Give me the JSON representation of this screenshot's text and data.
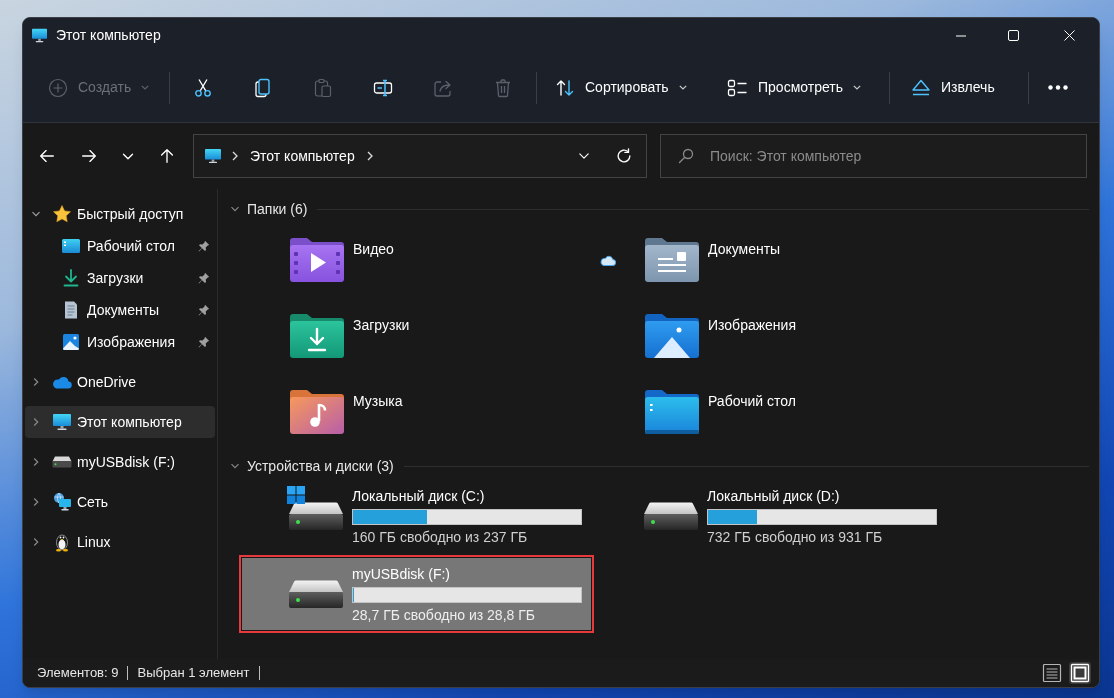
{
  "window": {
    "title": "Этот компьютер"
  },
  "toolbar": {
    "groups": [
      [
        {
          "kind": "new",
          "label": "Создать",
          "disabled": true,
          "dropdown": true
        }
      ],
      [
        {
          "kind": "cut",
          "disabled": false
        },
        {
          "kind": "copy",
          "disabled": false
        },
        {
          "kind": "paste",
          "disabled": true
        },
        {
          "kind": "rename",
          "disabled": false
        },
        {
          "kind": "share",
          "disabled": true
        },
        {
          "kind": "delete",
          "disabled": true
        }
      ],
      [
        {
          "kind": "sort",
          "label": "Сортировать",
          "disabled": false,
          "dropdown": true
        },
        {
          "kind": "view",
          "label": "Просмотреть",
          "disabled": false,
          "dropdown": true
        }
      ],
      [
        {
          "kind": "eject",
          "label": "Извлечь",
          "disabled": false,
          "dropdown": false
        }
      ],
      [
        {
          "kind": "more",
          "disabled": false
        }
      ]
    ]
  },
  "navigation": {
    "buttons": [
      {
        "kind": "back"
      },
      {
        "kind": "forward"
      },
      {
        "kind": "recent"
      },
      {
        "kind": "up"
      }
    ],
    "address": {
      "kind": "computer",
      "crumbs": [
        "Этот компьютер"
      ]
    },
    "search": {
      "placeholder": "Поиск: Этот компьютер"
    }
  },
  "sidebar": {
    "items": [
      {
        "label": "Быстрый доступ",
        "kind": "quick_access",
        "expanded": true,
        "selected": false,
        "children": [
          {
            "label": "Рабочий стол",
            "kind": "desktop",
            "pinned": true,
            "selected": false
          },
          {
            "label": "Загрузки",
            "kind": "downloads",
            "pinned": true,
            "selected": false
          },
          {
            "label": "Документы",
            "kind": "documents",
            "pinned": true,
            "selected": false
          },
          {
            "label": "Изображения",
            "kind": "pictures",
            "pinned": true,
            "selected": false
          }
        ]
      },
      {
        "label": "OneDrive",
        "kind": "onedrive",
        "expanded": false,
        "selected": false
      },
      {
        "label": "Этот компьютер",
        "kind": "computer",
        "expanded": false,
        "selected": true
      },
      {
        "label": "myUSBdisk (F:)",
        "kind": "drive",
        "expanded": false,
        "selected": false
      },
      {
        "label": "Сеть",
        "kind": "network",
        "expanded": false,
        "selected": false
      },
      {
        "label": "Linux",
        "kind": "linux",
        "expanded": false,
        "selected": false
      }
    ]
  },
  "sections": [
    {
      "title": "Папки (6)",
      "kind": "folders",
      "expanded": true,
      "items": [
        {
          "name": "Видео",
          "kind": "videos",
          "cloud": false,
          "selected": false
        },
        {
          "name": "Документы",
          "kind": "documents",
          "cloud": true,
          "selected": false
        },
        {
          "name": "Загрузки",
          "kind": "downloads",
          "cloud": false,
          "selected": false
        },
        {
          "name": "Изображения",
          "kind": "pictures",
          "cloud": false,
          "selected": false
        },
        {
          "name": "Музыка",
          "kind": "music",
          "cloud": false,
          "selected": false
        },
        {
          "name": "Рабочий стол",
          "kind": "desktop",
          "cloud": false,
          "selected": false
        }
      ]
    },
    {
      "title": "Устройства и диски (3)",
      "kind": "drives",
      "expanded": true,
      "items": [
        {
          "name": "Локальный диск (C:)",
          "kind": "system",
          "level": 0.325,
          "space": "160 ГБ свободно из 237 ГБ",
          "selected": false,
          "highlighted": false
        },
        {
          "name": "Локальный диск (D:)",
          "kind": "local",
          "level": 0.214,
          "space": "732 ГБ свободно из 931 ГБ",
          "selected": false,
          "highlighted": false
        },
        {
          "name": "myUSBdisk (F:)",
          "kind": "removable",
          "level": 0.003,
          "space": "28,7 ГБ свободно из 28,8 ГБ",
          "selected": true,
          "highlighted": true
        }
      ]
    }
  ],
  "status_bar": {
    "texts": [
      "Элементов: 9",
      "Выбран 1 элемент"
    ],
    "views": [
      {
        "kind": "details",
        "selected": false
      },
      {
        "kind": "tiles",
        "selected": true
      }
    ]
  }
}
